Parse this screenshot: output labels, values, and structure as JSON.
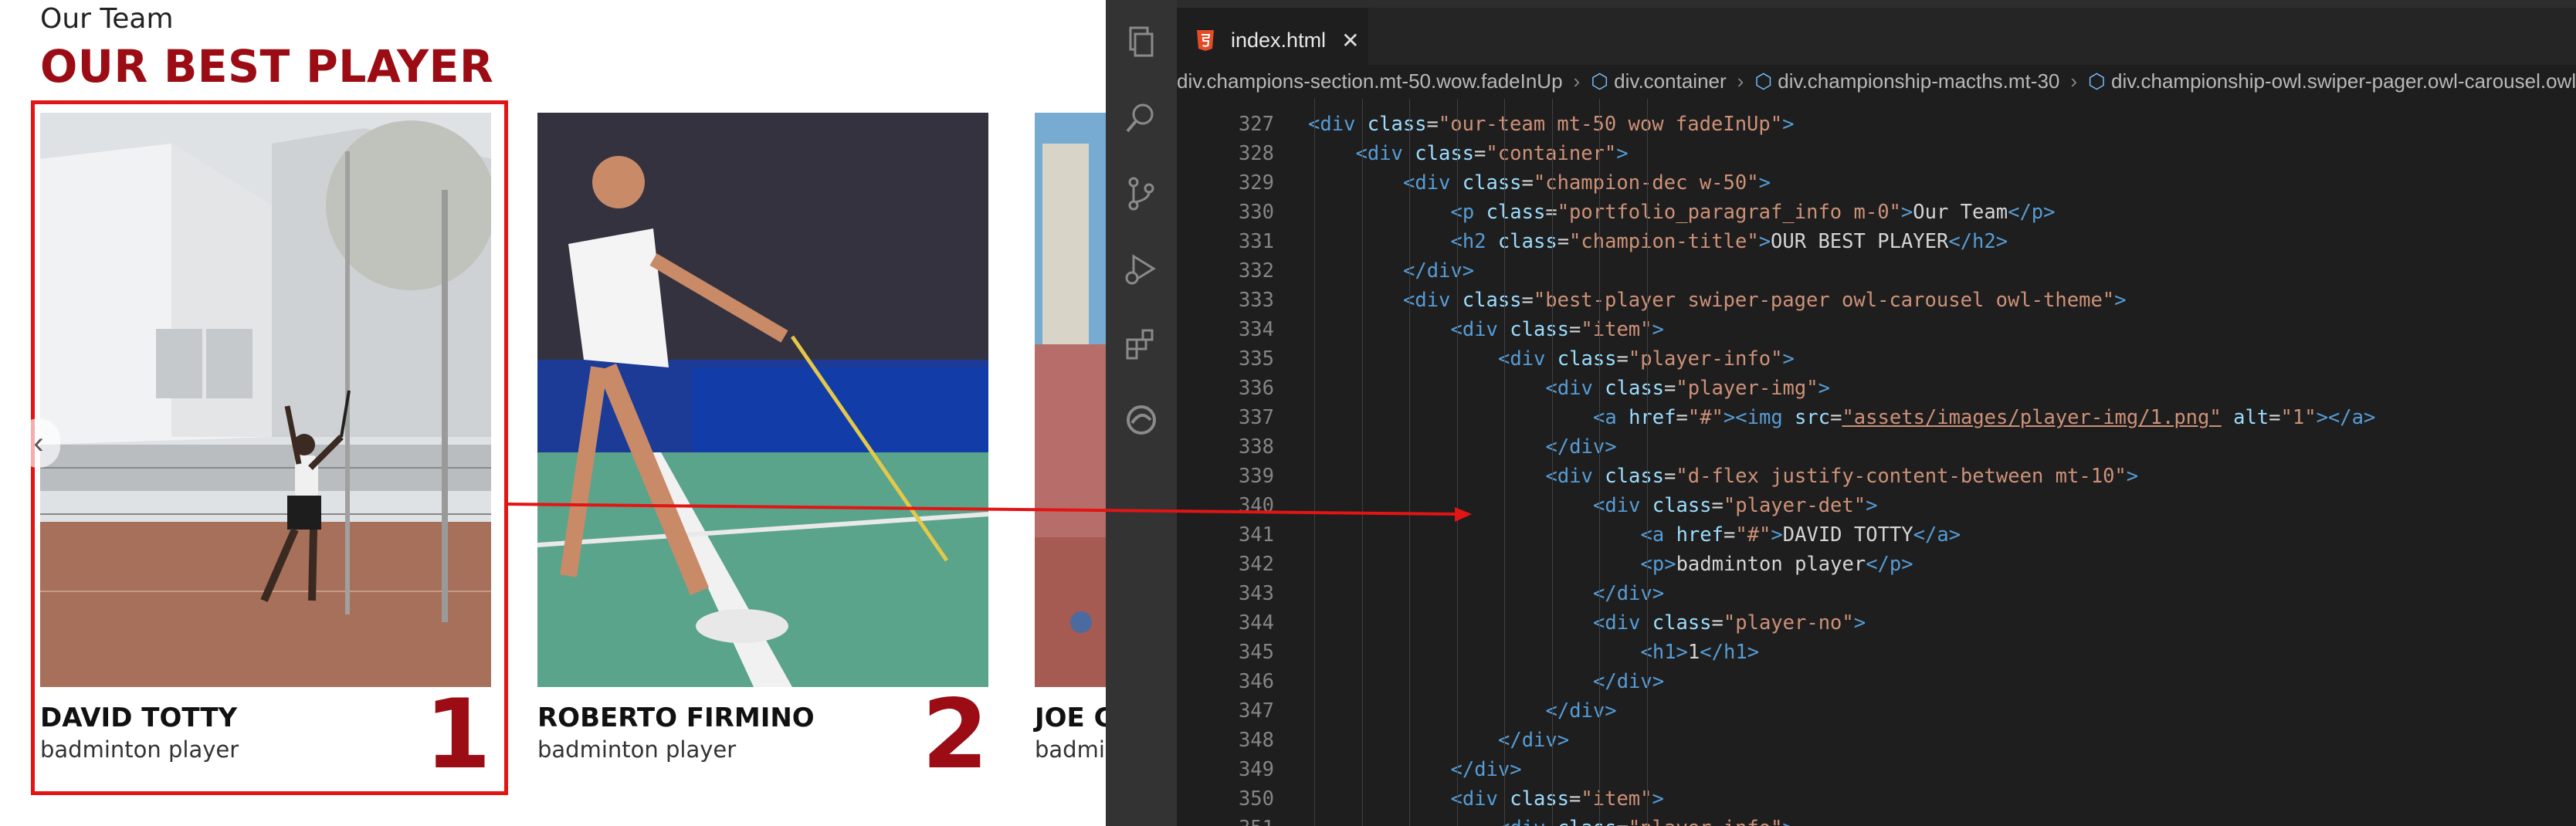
{
  "page": {
    "eyebrow": "Our Team",
    "title": "OUR BEST PLAYER",
    "prev_arrow": "‹",
    "players": [
      {
        "name": "DAVID TOTTY",
        "role": "badminton player",
        "number": "1"
      },
      {
        "name": "ROBERTO FIRMINO",
        "role": "badminton player",
        "number": "2"
      },
      {
        "name": "JOE G",
        "role": "badmi",
        "number": ""
      }
    ]
  },
  "editor": {
    "tab_title": "index.html",
    "tab_close": "✕",
    "breadcrumbs": [
      "div.champions-section.mt-50.wow.fadeInUp",
      "div.container",
      "div.championship-macths.mt-30",
      "div.championship-owl.swiper-pager.owl-carousel.owl-"
    ],
    "lines": [
      {
        "n": "327",
        "indent": 1,
        "parts": [
          [
            "tag",
            "<div "
          ],
          [
            "attr",
            "class"
          ],
          [
            "txt",
            "="
          ],
          [
            "str",
            "\"our-team mt-50 wow fadeInUp\""
          ],
          [
            "tag",
            ">"
          ]
        ]
      },
      {
        "n": "328",
        "indent": 2,
        "parts": [
          [
            "tag",
            "<div "
          ],
          [
            "attr",
            "class"
          ],
          [
            "txt",
            "="
          ],
          [
            "str",
            "\"container\""
          ],
          [
            "tag",
            ">"
          ]
        ]
      },
      {
        "n": "329",
        "indent": 3,
        "parts": [
          [
            "tag",
            "<div "
          ],
          [
            "attr",
            "class"
          ],
          [
            "txt",
            "="
          ],
          [
            "str",
            "\"champion-dec w-50\""
          ],
          [
            "tag",
            ">"
          ]
        ]
      },
      {
        "n": "330",
        "indent": 4,
        "parts": [
          [
            "tag",
            "<p "
          ],
          [
            "attr",
            "class"
          ],
          [
            "txt",
            "="
          ],
          [
            "str",
            "\"portfolio_paragraf_info m-0\""
          ],
          [
            "tag",
            ">"
          ],
          [
            "txt",
            "Our Team"
          ],
          [
            "tag",
            "</p>"
          ]
        ]
      },
      {
        "n": "331",
        "indent": 4,
        "parts": [
          [
            "tag",
            "<h2 "
          ],
          [
            "attr",
            "class"
          ],
          [
            "txt",
            "="
          ],
          [
            "str",
            "\"champion-title\""
          ],
          [
            "tag",
            ">"
          ],
          [
            "txt",
            "OUR BEST PLAYER"
          ],
          [
            "tag",
            "</h2>"
          ]
        ]
      },
      {
        "n": "332",
        "indent": 3,
        "parts": [
          [
            "tag",
            "</div>"
          ]
        ]
      },
      {
        "n": "333",
        "indent": 3,
        "parts": [
          [
            "tag",
            "<div "
          ],
          [
            "attr",
            "class"
          ],
          [
            "txt",
            "="
          ],
          [
            "str",
            "\"best-player swiper-pager owl-carousel owl-theme\""
          ],
          [
            "tag",
            ">"
          ]
        ]
      },
      {
        "n": "334",
        "indent": 4,
        "parts": [
          [
            "tag",
            "<div "
          ],
          [
            "attr",
            "class"
          ],
          [
            "txt",
            "="
          ],
          [
            "str",
            "\"item\""
          ],
          [
            "tag",
            ">"
          ]
        ]
      },
      {
        "n": "335",
        "indent": 5,
        "parts": [
          [
            "tag",
            "<div "
          ],
          [
            "attr",
            "class"
          ],
          [
            "txt",
            "="
          ],
          [
            "str",
            "\"player-info\""
          ],
          [
            "tag",
            ">"
          ]
        ]
      },
      {
        "n": "336",
        "indent": 6,
        "parts": [
          [
            "tag",
            "<div "
          ],
          [
            "attr",
            "class"
          ],
          [
            "txt",
            "="
          ],
          [
            "str",
            "\"player-img\""
          ],
          [
            "tag",
            ">"
          ]
        ]
      },
      {
        "n": "337",
        "indent": 7,
        "parts": [
          [
            "tag",
            "<a "
          ],
          [
            "attr",
            "href"
          ],
          [
            "txt",
            "="
          ],
          [
            "str",
            "\"#\""
          ],
          [
            "tag",
            "><img "
          ],
          [
            "attr",
            "src"
          ],
          [
            "txt",
            "="
          ],
          [
            "link",
            "\"assets/images/player-img/1.png\""
          ],
          [
            "txt",
            " "
          ],
          [
            "attr",
            "alt"
          ],
          [
            "txt",
            "="
          ],
          [
            "str",
            "\"1\""
          ],
          [
            "tag",
            "></a>"
          ]
        ]
      },
      {
        "n": "338",
        "indent": 6,
        "parts": [
          [
            "tag",
            "</div>"
          ]
        ]
      },
      {
        "n": "339",
        "indent": 6,
        "parts": [
          [
            "tag",
            "<div "
          ],
          [
            "attr",
            "class"
          ],
          [
            "txt",
            "="
          ],
          [
            "str",
            "\"d-flex justify-content-between mt-10\""
          ],
          [
            "tag",
            ">"
          ]
        ]
      },
      {
        "n": "340",
        "indent": 7,
        "parts": [
          [
            "tag",
            "<div "
          ],
          [
            "attr",
            "class"
          ],
          [
            "txt",
            "="
          ],
          [
            "str",
            "\"player-det\""
          ],
          [
            "tag",
            ">"
          ]
        ]
      },
      {
        "n": "341",
        "indent": 8,
        "parts": [
          [
            "tag",
            "<a "
          ],
          [
            "attr",
            "href"
          ],
          [
            "txt",
            "="
          ],
          [
            "str",
            "\"#\""
          ],
          [
            "tag",
            ">"
          ],
          [
            "txt",
            "DAVID TOTTY"
          ],
          [
            "tag",
            "</a>"
          ]
        ]
      },
      {
        "n": "342",
        "indent": 8,
        "parts": [
          [
            "tag",
            "<p>"
          ],
          [
            "txt",
            "badminton player"
          ],
          [
            "tag",
            "</p>"
          ]
        ]
      },
      {
        "n": "343",
        "indent": 7,
        "parts": [
          [
            "tag",
            "</div>"
          ]
        ]
      },
      {
        "n": "344",
        "indent": 7,
        "parts": [
          [
            "tag",
            "<div "
          ],
          [
            "attr",
            "class"
          ],
          [
            "txt",
            "="
          ],
          [
            "str",
            "\"player-no\""
          ],
          [
            "tag",
            ">"
          ]
        ]
      },
      {
        "n": "345",
        "indent": 8,
        "parts": [
          [
            "tag",
            "<h1>"
          ],
          [
            "txt",
            "1"
          ],
          [
            "tag",
            "</h1>"
          ]
        ]
      },
      {
        "n": "346",
        "indent": 7,
        "parts": [
          [
            "tag",
            "</div>"
          ]
        ]
      },
      {
        "n": "347",
        "indent": 6,
        "parts": [
          [
            "tag",
            "</div>"
          ]
        ]
      },
      {
        "n": "348",
        "indent": 5,
        "parts": [
          [
            "tag",
            "</div>"
          ]
        ]
      },
      {
        "n": "349",
        "indent": 4,
        "parts": [
          [
            "tag",
            "</div>"
          ]
        ]
      },
      {
        "n": "350",
        "indent": 4,
        "parts": [
          [
            "tag",
            "<div "
          ],
          [
            "attr",
            "class"
          ],
          [
            "txt",
            "="
          ],
          [
            "str",
            "\"item\""
          ],
          [
            "tag",
            ">"
          ]
        ]
      },
      {
        "n": "351",
        "indent": 5,
        "parts": [
          [
            "tag",
            "<div "
          ],
          [
            "attr",
            "class"
          ],
          [
            "txt",
            "="
          ],
          [
            "str",
            "\"player-info\""
          ],
          [
            "tag",
            ">"
          ]
        ]
      }
    ]
  },
  "colors": {
    "accent": "#9b0c14",
    "highlight": "#e21414",
    "editor_bg": "#1e1e1e"
  },
  "icons": [
    "files-icon",
    "search-icon",
    "source-control-icon",
    "run-debug-icon",
    "extensions-icon",
    "edge-icon",
    "html5-icon",
    "chevron-left-icon"
  ]
}
